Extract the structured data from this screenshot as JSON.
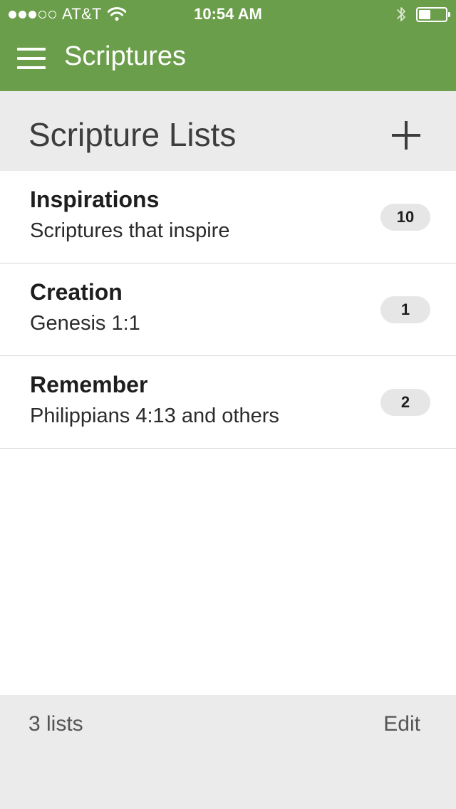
{
  "status_bar": {
    "signal_dots_filled": 3,
    "signal_dots_total": 5,
    "carrier": "AT&T",
    "time": "10:54 AM",
    "battery_level": 0.45
  },
  "navbar": {
    "title": "Scriptures",
    "background_color": "#6b9e4a"
  },
  "section": {
    "title": "Scripture Lists"
  },
  "lists": [
    {
      "title": "Inspirations",
      "subtitle": "Scriptures that inspire",
      "count": "10"
    },
    {
      "title": "Creation",
      "subtitle": "Genesis 1:1",
      "count": "1"
    },
    {
      "title": "Remember",
      "subtitle": "Philippians 4:13 and others",
      "count": "2"
    }
  ],
  "footer": {
    "count_label": "3 lists",
    "edit_label": "Edit"
  },
  "icons": {
    "menu": "hamburger-menu-icon",
    "add": "plus-icon",
    "wifi": "wifi-icon",
    "bluetooth": "bluetooth-icon",
    "battery": "battery-icon"
  }
}
